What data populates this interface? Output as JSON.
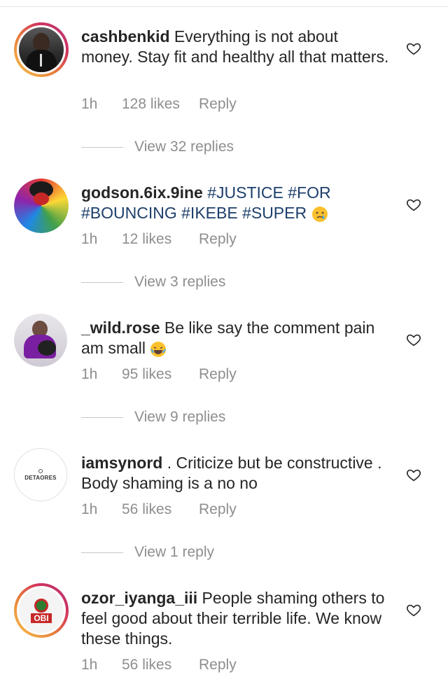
{
  "comments": [
    {
      "username": "cashbenkid",
      "text_before": " Everything is not about money. Stay fit and healthy all that matters.",
      "hashtags": "",
      "time": "1h",
      "likes": "128 likes",
      "reply": "Reply",
      "view_replies": "View 32 replies"
    },
    {
      "username": "godson.6ix.9ine",
      "text_before": " ",
      "hashtags": "#JUSTICE #FOR #BOUNCING #IKEBE #SUPER",
      "emoji": "crying-face",
      "time": "1h",
      "likes": "12 likes",
      "reply": "Reply",
      "view_replies": "View 3 replies"
    },
    {
      "username": "_wild.rose",
      "text_before": " Be like say the comment pain am small",
      "emoji": "tears-of-joy-face",
      "time": "1h",
      "likes": "95 likes",
      "reply": "Reply",
      "view_replies": "View 9 replies"
    },
    {
      "username": "iamsynord",
      "text_before": " . Criticize but be constructive . Body shaming is a no no",
      "avatar_text": "DETAORES",
      "time": "1h",
      "likes": "56 likes",
      "reply": "Reply",
      "view_replies": "View 1 reply"
    },
    {
      "username": "ozor_iyanga_iii",
      "text_before": " People shaming others to feel good about their terrible life. We know these things.",
      "avatar_text": "OBI",
      "time": "1h",
      "likes": "56 likes",
      "reply": "Reply"
    }
  ],
  "colors": {
    "text": "#262626",
    "meta": "#8e8e8e",
    "hashtag": "#1d3f6b"
  }
}
